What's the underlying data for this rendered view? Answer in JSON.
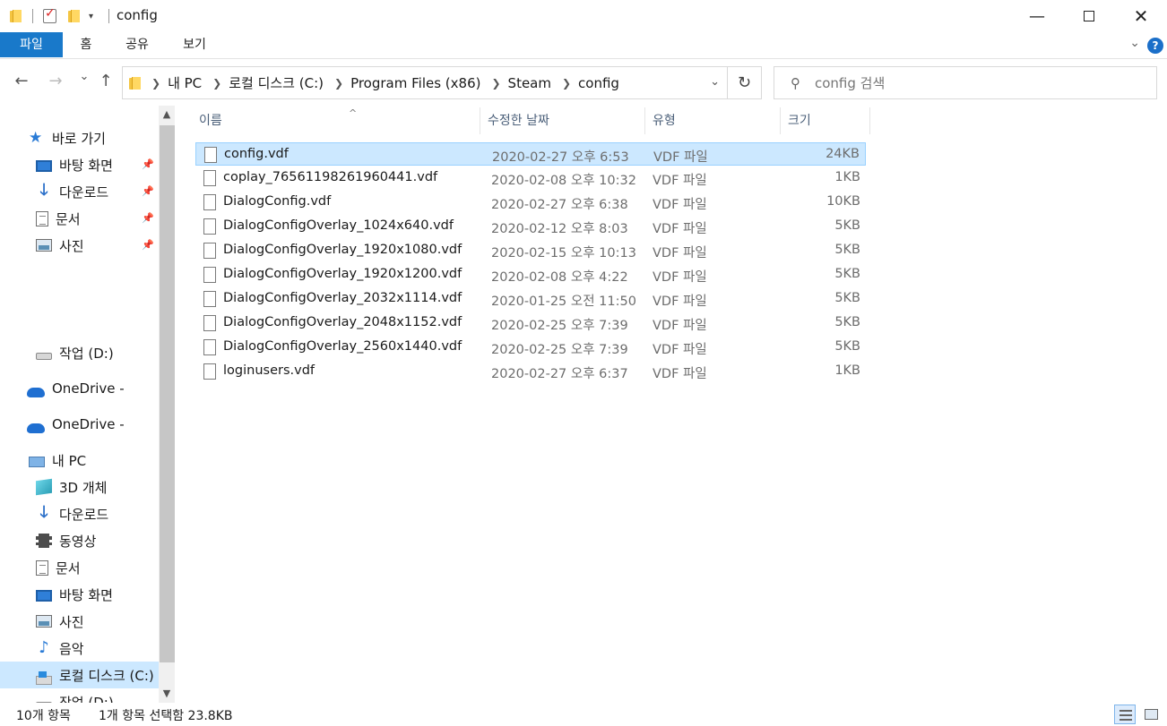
{
  "window": {
    "title": "config",
    "minimize_icon": "minimize-icon",
    "maximize_icon": "maximize-icon",
    "close_icon": "close-icon"
  },
  "ribbon": {
    "tabs": [
      "파일",
      "홈",
      "공유",
      "보기"
    ],
    "accent": "#1979ca"
  },
  "nav": {
    "back": "←",
    "forward": "→",
    "recent": "⌄",
    "up": "↑",
    "breadcrumbs": [
      "내 PC",
      "로컬 디스크 (C:)",
      "Program Files (x86)",
      "Steam",
      "config"
    ],
    "search_placeholder": "config 검색"
  },
  "sidebar": {
    "quick_access": {
      "label": "바로 가기",
      "items": [
        {
          "label": "바탕 화면",
          "icon": "desktop-icon",
          "pinned": true
        },
        {
          "label": "다운로드",
          "icon": "download-icon",
          "pinned": true
        },
        {
          "label": "문서",
          "icon": "document-icon",
          "pinned": true
        },
        {
          "label": "사진",
          "icon": "pictures-icon",
          "pinned": true
        }
      ]
    },
    "drive_d": "작업 (D:)",
    "onedrive_1": "OneDrive -",
    "onedrive_2": "OneDrive -",
    "this_pc": {
      "label": "내 PC",
      "items": [
        {
          "label": "3D 개체",
          "icon": "3d-objects-icon"
        },
        {
          "label": "다운로드",
          "icon": "download-icon"
        },
        {
          "label": "동영상",
          "icon": "videos-icon"
        },
        {
          "label": "문서",
          "icon": "document-icon"
        },
        {
          "label": "바탕 화면",
          "icon": "desktop-icon"
        },
        {
          "label": "사진",
          "icon": "pictures-icon"
        },
        {
          "label": "음악",
          "icon": "music-icon"
        },
        {
          "label": "로컬 디스크 (C:)",
          "icon": "local-disk-icon",
          "selected": true
        },
        {
          "label": "작업 (D:)",
          "icon": "drive-icon"
        }
      ]
    }
  },
  "columns": {
    "name": "이름",
    "date": "수정한 날짜",
    "type": "유형",
    "size": "크기"
  },
  "files": [
    {
      "name": "config.vdf",
      "date": "2020-02-27 오후 6:53",
      "type": "VDF 파일",
      "size": "24KB",
      "selected": true
    },
    {
      "name": "coplay_76561198261960441.vdf",
      "date": "2020-02-08 오후 10:32",
      "type": "VDF 파일",
      "size": "1KB"
    },
    {
      "name": "DialogConfig.vdf",
      "date": "2020-02-27 오후 6:38",
      "type": "VDF 파일",
      "size": "10KB"
    },
    {
      "name": "DialogConfigOverlay_1024x640.vdf",
      "date": "2020-02-12 오후 8:03",
      "type": "VDF 파일",
      "size": "5KB"
    },
    {
      "name": "DialogConfigOverlay_1920x1080.vdf",
      "date": "2020-02-15 오후 10:13",
      "type": "VDF 파일",
      "size": "5KB"
    },
    {
      "name": "DialogConfigOverlay_1920x1200.vdf",
      "date": "2020-02-08 오후 4:22",
      "type": "VDF 파일",
      "size": "5KB"
    },
    {
      "name": "DialogConfigOverlay_2032x1114.vdf",
      "date": "2020-01-25 오전 11:50",
      "type": "VDF 파일",
      "size": "5KB"
    },
    {
      "name": "DialogConfigOverlay_2048x1152.vdf",
      "date": "2020-02-25 오후 7:39",
      "type": "VDF 파일",
      "size": "5KB"
    },
    {
      "name": "DialogConfigOverlay_2560x1440.vdf",
      "date": "2020-02-25 오후 7:39",
      "type": "VDF 파일",
      "size": "5KB"
    },
    {
      "name": "loginusers.vdf",
      "date": "2020-02-27 오후 6:37",
      "type": "VDF 파일",
      "size": "1KB"
    }
  ],
  "status": {
    "item_count": "10개 항목",
    "selection": "1개 항목 선택함 23.8KB"
  },
  "colors": {
    "selection_bg": "#cce8ff",
    "selection_border": "#99d1ff",
    "header_text": "#4c607a"
  }
}
